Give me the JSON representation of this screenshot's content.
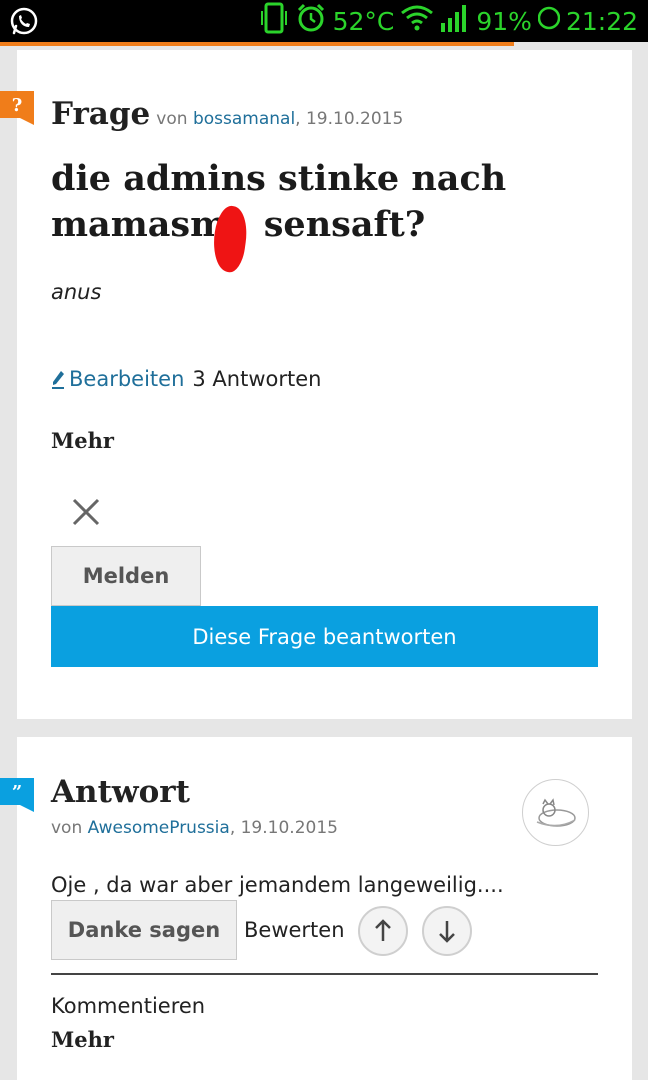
{
  "status_bar": {
    "temperature": "52°C",
    "battery": "91%",
    "time": "21:22",
    "icons": [
      "whatsapp-icon",
      "vibrate-icon",
      "alarm-icon",
      "wifi-icon",
      "signal-icon",
      "battery-icon"
    ]
  },
  "colors": {
    "accent_orange": "#f07d1a",
    "flag_answer": "#0aa0e0",
    "primary_button": "#0aa0e0",
    "link": "#1f6f9a",
    "status_green": "#2bd42b",
    "scribble_red": "#ef1414"
  },
  "question": {
    "flag_glyph": "?",
    "type_label": "Frage",
    "by_label": "von",
    "author": "bossamanal",
    "date": ", 19.10.2015",
    "title_line1": "die admins stinke nach",
    "title_line2": "mamasm   sensaft?",
    "body": "anus",
    "edit_label": "Bearbeiten",
    "answers_count": "3 Antworten",
    "more_label": "Mehr",
    "report_button": "Melden",
    "answer_button": "Diese Frage beantworten"
  },
  "answer": {
    "flag_glyph": "”",
    "type_label": "Antwort",
    "by_label": "von",
    "author": "AwesomePrussia",
    "date": ", 19.10.2015",
    "body": "Oje , da war aber jemandem langeweilig....",
    "thanks_button": "Danke sagen",
    "rate_label": "Bewerten",
    "comment_label": "Kommentieren",
    "more_label": "Mehr"
  }
}
